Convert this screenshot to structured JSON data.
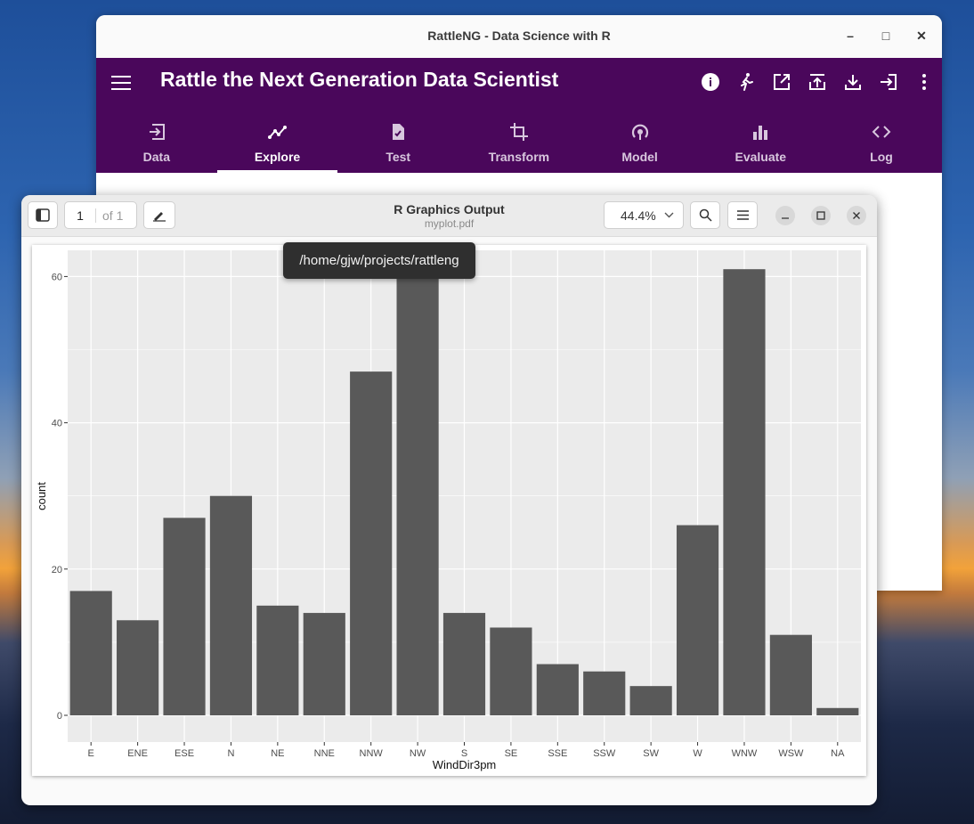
{
  "rattle_window": {
    "title": "RattleNG - Data Science with R",
    "controls": {
      "minimize": "–",
      "maximize": "□",
      "close": "✕"
    },
    "app_title": "Rattle the Next Generation Data Scientist",
    "actions": [
      "info-icon",
      "runner-icon",
      "open-in-new-icon",
      "upload-icon",
      "download-icon",
      "login-icon",
      "more-vert-icon"
    ],
    "tabs": [
      {
        "label": "Data",
        "icon": "input-icon"
      },
      {
        "label": "Explore",
        "icon": "insights-icon",
        "active": true
      },
      {
        "label": "Test",
        "icon": "task-icon"
      },
      {
        "label": "Transform",
        "icon": "crop-icon"
      },
      {
        "label": "Model",
        "icon": "model-icon"
      },
      {
        "label": "Evaluate",
        "icon": "bar-chart-icon"
      },
      {
        "label": "Log",
        "icon": "code-icon"
      }
    ],
    "accent_color": "#4a075b"
  },
  "viewer": {
    "title": "R Graphics Output",
    "subtitle": "myplot.pdf",
    "page_current": "1",
    "page_total": "of 1",
    "zoom": "44.4%",
    "tooltip": "/home/gjw/projects/rattleng",
    "controls": {
      "minimize": "–",
      "maximize": "□",
      "close": "✕"
    }
  },
  "chart_data": {
    "type": "bar",
    "xlabel": "WindDir3pm",
    "ylabel": "count",
    "categories": [
      "E",
      "ENE",
      "ESE",
      "N",
      "NE",
      "NNE",
      "NNW",
      "NW",
      "S",
      "SE",
      "SSE",
      "SSW",
      "SW",
      "W",
      "WNW",
      "WSW",
      "NA"
    ],
    "values": [
      17,
      13,
      27,
      30,
      15,
      14,
      47,
      61,
      14,
      12,
      7,
      6,
      4,
      26,
      61,
      11,
      1
    ],
    "ylim": [
      0,
      63
    ],
    "yticks": [
      0,
      20,
      40,
      60
    ],
    "grid": true,
    "bar_color": "#595959",
    "panel_color": "#ebebeb"
  }
}
